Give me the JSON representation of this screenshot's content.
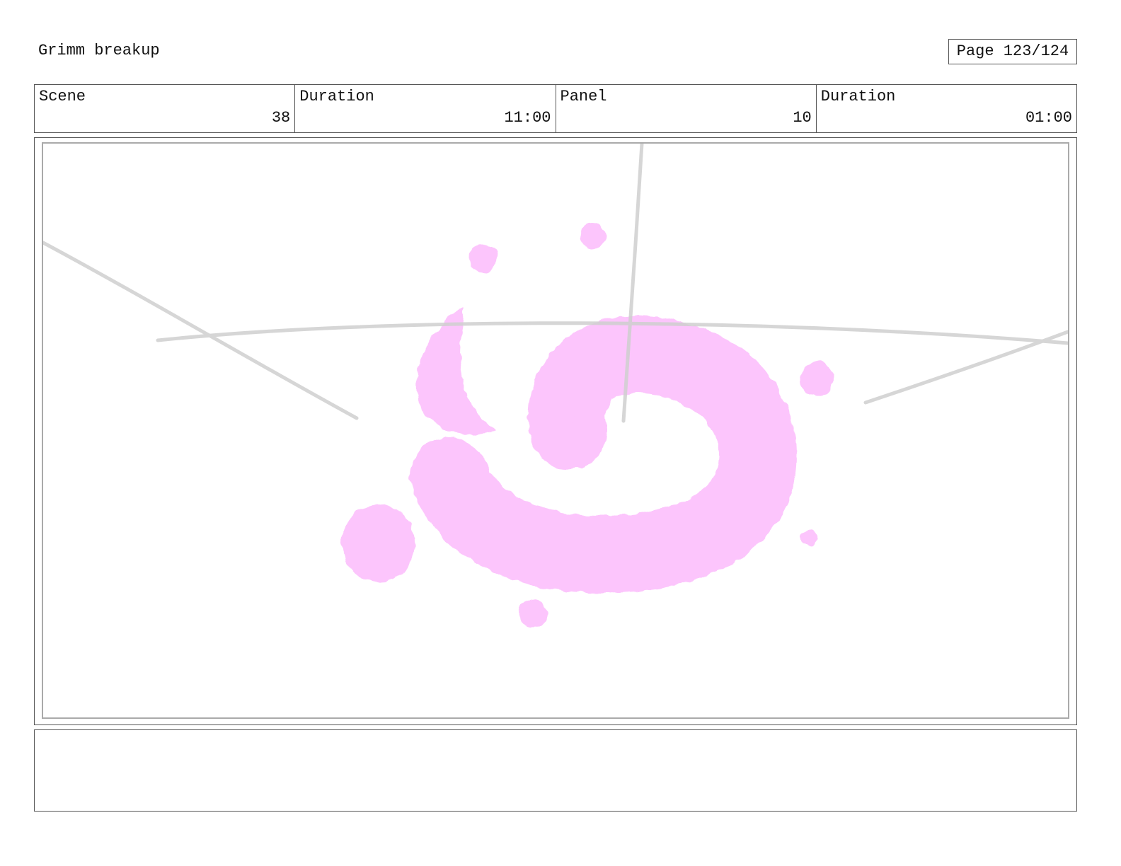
{
  "header": {
    "project_title": "Grimm breakup",
    "page_label": "Page 123/124"
  },
  "info": {
    "scene_label": "Scene",
    "scene_value": "38",
    "scene_duration_label": "Duration",
    "scene_duration_value": "11:00",
    "panel_label": "Panel",
    "panel_value": "10",
    "panel_duration_label": "Duration",
    "panel_duration_value": "01:00"
  },
  "artwork": {
    "effect_color": "#fcc5fc",
    "guide_color": "#cfcfcf"
  },
  "notes": {
    "text": ""
  }
}
